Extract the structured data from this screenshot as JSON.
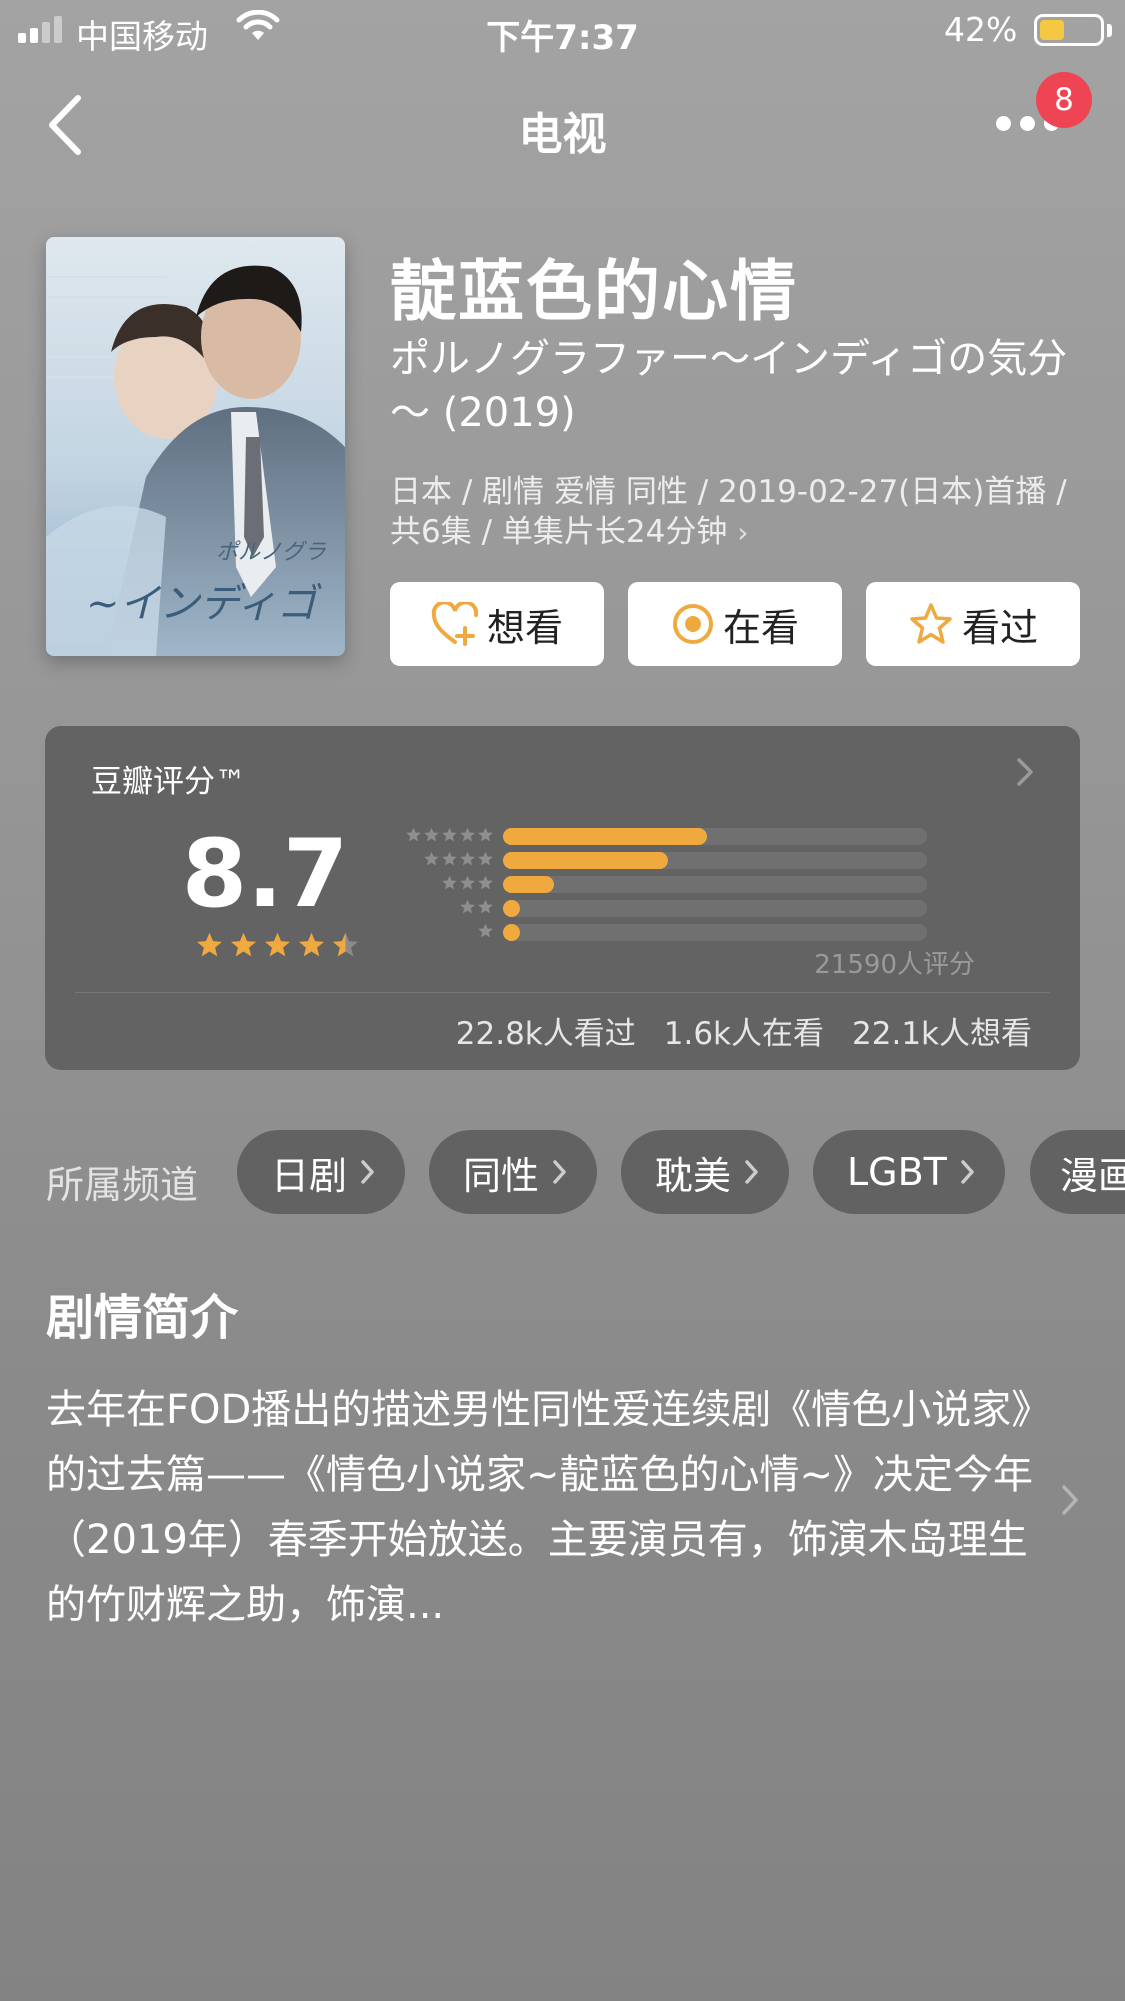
{
  "status_bar": {
    "carrier": "中国移动",
    "time": "下午7:37",
    "battery_percent": "42%",
    "battery_level": 0.42,
    "battery_color": "#f5c842"
  },
  "nav": {
    "title": "电视",
    "badge": "8",
    "badge_color": "#ef4453"
  },
  "movie": {
    "title": "靛蓝色的心情",
    "subtitle": "ポルノグラファー～インディゴの気分～ (2019)",
    "meta": "日本 / 剧情 爱情 同性 / 2019-02-27(日本)首播 / 共6集 / 单集片长24分钟",
    "poster_text": "ポルノグラ ~インディゴ"
  },
  "actions": [
    {
      "label": "想看",
      "icon": "heart-plus-icon"
    },
    {
      "label": "在看",
      "icon": "target-circle-icon"
    },
    {
      "label": "看过",
      "icon": "star-outline-icon"
    }
  ],
  "rating": {
    "label": "豆瓣评分™",
    "score": "8.7",
    "stars": 4.5,
    "distribution": [
      0.48,
      0.39,
      0.12,
      0.04,
      0.04
    ],
    "count_text": "21590人评分",
    "accent_color": "#f0a93f",
    "stats": [
      "22.8k人看过",
      "1.6k人在看",
      "22.1k人想看"
    ]
  },
  "channels": {
    "label": "所属频道",
    "items": [
      "日剧",
      "同性",
      "耽美",
      "LGBT",
      "漫画"
    ]
  },
  "synopsis": {
    "title": "剧情简介",
    "text": "去年在FOD播出的描述男性同性爱连续剧《情色小说家》的过去篇——《情色小说家~靛蓝色的心情~》决定今年（2019年）春季开始放送。主要演员有，饰演木岛理生的竹财辉之助，饰演..."
  }
}
